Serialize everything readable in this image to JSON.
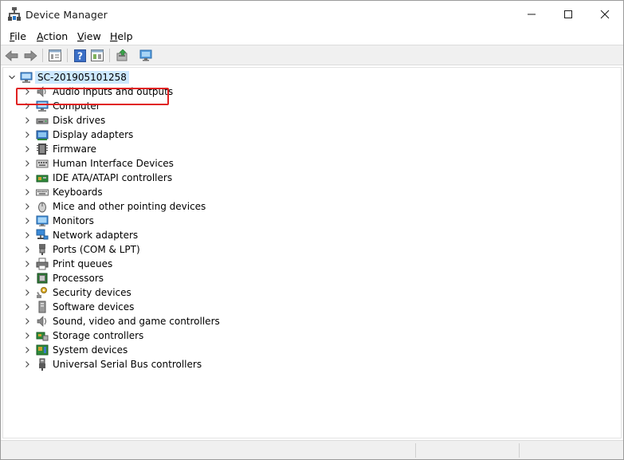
{
  "window": {
    "title": "Device Manager",
    "controls": {
      "minimize": "minimize",
      "maximize": "maximize",
      "close": "close"
    }
  },
  "menu": [
    {
      "label": "File",
      "accel": "F",
      "rest": "ile"
    },
    {
      "label": "Action",
      "accel": "A",
      "rest": "ction"
    },
    {
      "label": "View",
      "accel": "V",
      "rest": "iew"
    },
    {
      "label": "Help",
      "accel": "H",
      "rest": "elp"
    }
  ],
  "toolbar": {
    "buttons": [
      "back-icon",
      "forward-icon",
      "properties-icon",
      "help-icon",
      "view-icon",
      "update-driver-icon",
      "scan-hardware-icon"
    ]
  },
  "tree": {
    "root": {
      "label": "SC-201905101258",
      "expanded": true
    },
    "categories": [
      {
        "label": "Audio inputs and outputs",
        "icon": "speaker-icon"
      },
      {
        "label": "Computer",
        "icon": "computer-icon"
      },
      {
        "label": "Disk drives",
        "icon": "disk-drive-icon"
      },
      {
        "label": "Display adapters",
        "icon": "display-adapter-icon"
      },
      {
        "label": "Firmware",
        "icon": "firmware-icon"
      },
      {
        "label": "Human Interface Devices",
        "icon": "hid-icon",
        "highlighted": true
      },
      {
        "label": "IDE ATA/ATAPI controllers",
        "icon": "ide-controller-icon"
      },
      {
        "label": "Keyboards",
        "icon": "keyboard-icon"
      },
      {
        "label": "Mice and other pointing devices",
        "icon": "mouse-icon"
      },
      {
        "label": "Monitors",
        "icon": "monitor-icon"
      },
      {
        "label": "Network adapters",
        "icon": "network-adapter-icon"
      },
      {
        "label": "Ports (COM & LPT)",
        "icon": "port-icon"
      },
      {
        "label": "Print queues",
        "icon": "printer-icon"
      },
      {
        "label": "Processors",
        "icon": "processor-icon"
      },
      {
        "label": "Security devices",
        "icon": "security-key-icon"
      },
      {
        "label": "Software devices",
        "icon": "software-device-icon"
      },
      {
        "label": "Sound, video and game controllers",
        "icon": "sound-icon"
      },
      {
        "label": "Storage controllers",
        "icon": "storage-controller-icon"
      },
      {
        "label": "System devices",
        "icon": "system-device-icon"
      },
      {
        "label": "Universal Serial Bus controllers",
        "icon": "usb-icon"
      }
    ]
  },
  "colors": {
    "selection": "#cce8ff",
    "highlight_box": "#e02020",
    "chrome": "#f0f0f0"
  }
}
